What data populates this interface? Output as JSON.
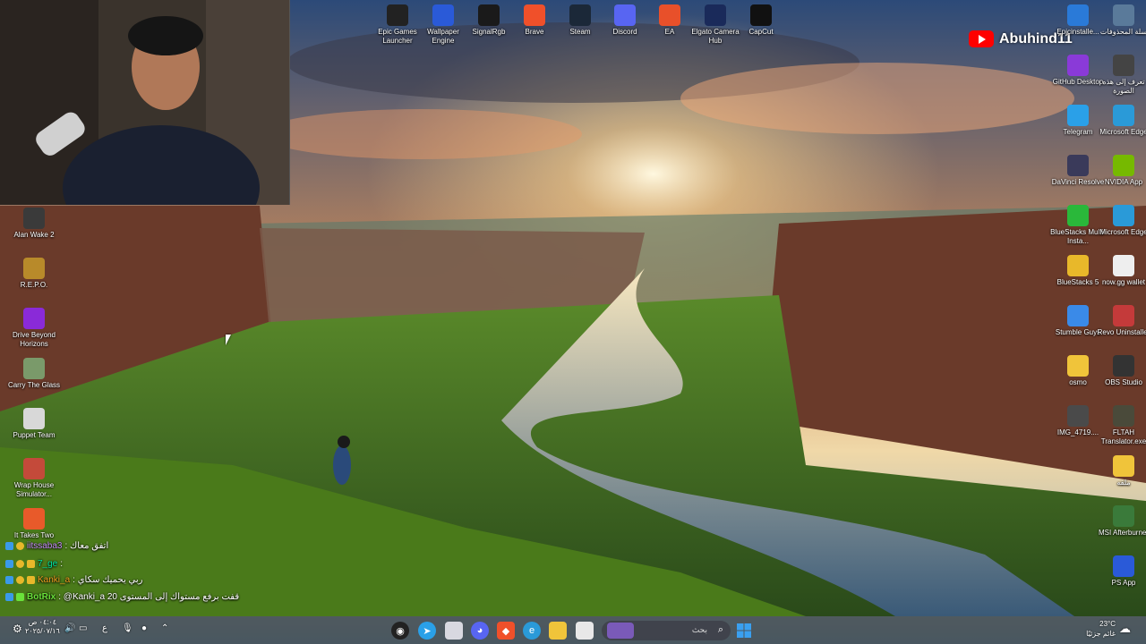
{
  "streamer": {
    "channel_name": "Abuhind11"
  },
  "desktop_left": [
    {
      "label": "Alan Wake 2",
      "icon": "alan-wake-2-icon",
      "color": "#3a3a3a"
    },
    {
      "label": "R.E.P.O.",
      "icon": "repo-icon",
      "color": "#b88a2a"
    },
    {
      "label": "Drive Beyond Horizons",
      "icon": "drive-beyond-horizons-icon",
      "color": "#8a2ad8"
    },
    {
      "label": "Carry The Glass",
      "icon": "carry-the-glass-icon",
      "color": "#7a9a6a"
    },
    {
      "label": "Puppet Team",
      "icon": "puppet-team-icon",
      "color": "#d8d8d8"
    },
    {
      "label": "Wrap House Simulator...",
      "icon": "wrap-house-simulator-icon",
      "color": "#c44a3a"
    },
    {
      "label": "It Takes Two",
      "icon": "it-takes-two-icon",
      "color": "#e85a2a"
    }
  ],
  "desktop_top": [
    {
      "label": "Epic Games Launcher",
      "icon": "epic-games-icon",
      "color": "#222222"
    },
    {
      "label": "Wallpaper Engine",
      "icon": "wallpaper-engine-icon",
      "color": "#2a5ad8"
    },
    {
      "label": "SignalRgb",
      "icon": "signalrgb-icon",
      "color": "#1a1a1a"
    },
    {
      "label": "Brave",
      "icon": "brave-icon",
      "color": "#f0502a"
    },
    {
      "label": "Steam",
      "icon": "steam-icon",
      "color": "#1b2838"
    },
    {
      "label": "Discord",
      "icon": "discord-icon",
      "color": "#5865f2"
    },
    {
      "label": "EA",
      "icon": "ea-icon",
      "color": "#e8502a"
    },
    {
      "label": "Elgato Camera Hub",
      "icon": "elgato-camera-hub-icon",
      "color": "#1a2a5a"
    },
    {
      "label": "CapCut",
      "icon": "capcut-icon",
      "color": "#111111"
    }
  ],
  "desktop_right_col1": [
    {
      "label": "Epicinstalle...",
      "icon": "epic-installer-icon",
      "color": "#2a7ad8"
    },
    {
      "label": "GitHub Desktop",
      "icon": "github-desktop-icon",
      "color": "#8a3ad8"
    },
    {
      "label": "Telegram",
      "icon": "telegram-icon",
      "color": "#2aa0e8"
    },
    {
      "label": "DaVinci Resolve",
      "icon": "davinci-resolve-icon",
      "color": "#3a3a5a"
    },
    {
      "label": "BlueStacks Multi-Insta...",
      "icon": "bluestacks-multi-icon",
      "color": "#2ab83a"
    },
    {
      "label": "BlueStacks 5",
      "icon": "bluestacks-5-icon",
      "color": "#e8b82a"
    },
    {
      "label": "Stumble Guys",
      "icon": "stumble-guys-icon",
      "color": "#3a8ae8"
    },
    {
      "label": "osmo",
      "icon": "folder-icon",
      "color": "#f0c43a"
    },
    {
      "label": "IMG_4719....",
      "icon": "image-file-icon",
      "color": "#4a4a4a"
    }
  ],
  "desktop_right_col2": [
    {
      "label": "سلة المحذوفات",
      "icon": "recycle-bin-icon",
      "color": "#5a7a9a"
    },
    {
      "label": "تعرف إلى هذه الصورة",
      "icon": "spotlight-icon",
      "color": "#444444"
    },
    {
      "label": "Microsoft Edge",
      "icon": "edge-icon",
      "color": "#2a9ad8"
    },
    {
      "label": "NVIDIA App",
      "icon": "nvidia-app-icon",
      "color": "#76b900"
    },
    {
      "label": "Microsoft Edge",
      "icon": "edge-icon",
      "color": "#2a9ad8"
    },
    {
      "label": "now.gg wallet",
      "icon": "document-icon",
      "color": "#eeeeee"
    },
    {
      "label": "Revo Uninstaller",
      "icon": "revo-uninstaller-icon",
      "color": "#c43a3a"
    },
    {
      "label": "OBS Studio",
      "icon": "obs-studio-icon",
      "color": "#333333"
    },
    {
      "label": "FLTAH Translator.exe",
      "icon": "fltah-translator-icon",
      "color": "#4a4a3a"
    },
    {
      "label": "ملفه",
      "icon": "folder-icon",
      "color": "#f0c43a"
    },
    {
      "label": "MSI Afterburner",
      "icon": "msi-afterburner-icon",
      "color": "#3a7a3a"
    },
    {
      "label": "PS App",
      "icon": "ps-app-icon",
      "color": "#2a5ad8"
    }
  ],
  "chat": [
    {
      "user": "iitssaba3",
      "message": ": اتفق معاك",
      "user_color": "#c58af9"
    },
    {
      "user": "7_ge",
      "message": ":",
      "user_color": "#00e5a0"
    },
    {
      "user": "Kanki_a",
      "message": ": ربي يحميك سكاي",
      "user_color": "#f0a020"
    },
    {
      "user": "BotRix",
      "message": ": @Kanki_a قفت برفع مستواك إلى المستوى 20",
      "user_color": "#6ae23a"
    }
  ],
  "taskbar": {
    "time": "٠٤:٠٤ ص",
    "date": "٢٠٢٥/٠٧/١٦",
    "search_placeholder": "بحث",
    "weather_temp": "23°C",
    "weather_desc": "غائم جزئيًا",
    "lang": "ع"
  },
  "colors": {
    "taskbar_bg": "#141418",
    "accent": "#0078d4"
  }
}
